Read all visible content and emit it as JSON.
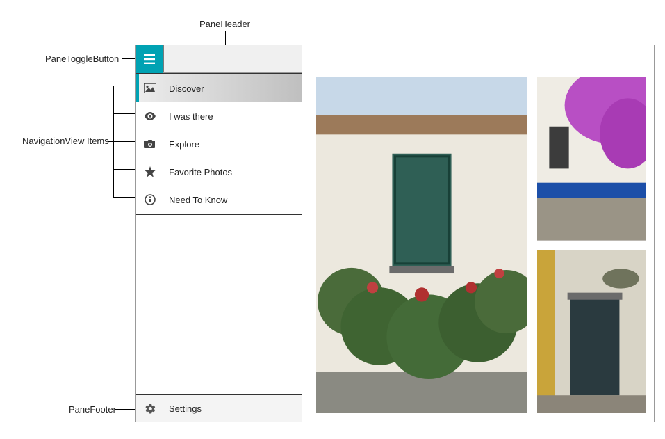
{
  "annotations": {
    "paneHeader": "PaneHeader",
    "paneToggleButton": "PaneToggleButton",
    "navigationViewItems": "NavigationView Items",
    "paneFooter": "PaneFooter"
  },
  "nav": {
    "items": [
      {
        "label": "Discover",
        "icon": "image-icon",
        "selected": true
      },
      {
        "label": "I was there",
        "icon": "eye-icon",
        "selected": false
      },
      {
        "label": "Explore",
        "icon": "camera-icon",
        "selected": false
      },
      {
        "label": "Favorite Photos",
        "icon": "star-icon",
        "selected": false
      },
      {
        "label": "Need To Know",
        "icon": "info-icon",
        "selected": false
      }
    ]
  },
  "footer": {
    "label": "Settings",
    "icon": "gear-icon"
  }
}
